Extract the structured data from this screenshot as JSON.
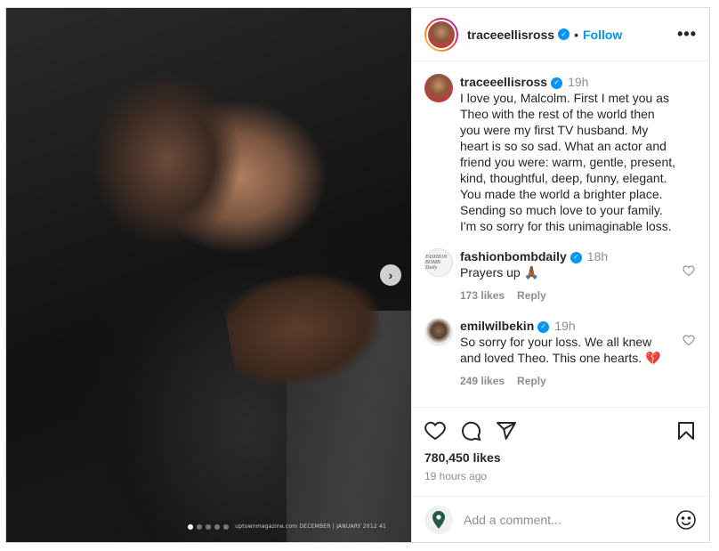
{
  "post": {
    "author": "traceeellisross",
    "follow_label": "Follow",
    "separator": "•",
    "more_label": "•••"
  },
  "media": {
    "magazine_text": "uptownmagazine.com   DECEMBER | JANUARY 2012   41",
    "next_label": "›",
    "slide_count": 5,
    "active_slide": 1
  },
  "caption": {
    "user": "traceeellisross",
    "time": "19h",
    "text": "I love you, Malcolm. First I met you as Theo with the rest of the world then you were my first TV husband. My heart is so so sad. What an actor and friend you were: warm, gentle, present, kind, thoughtful, deep, funny, elegant. You made the world a brighter place. Sending so much love to your family. I'm so sorry for this unimaginable loss."
  },
  "comments": [
    {
      "user": "fashionbombdaily",
      "time": "18h",
      "text": "Prayers up 🙏🏾",
      "likes": "173 likes",
      "reply": "Reply"
    },
    {
      "user": "emilwilbekin",
      "time": "19h",
      "text": "So sorry for your loss. We all knew and loved Theo. This one hearts. 💔",
      "likes": "249 likes",
      "reply": "Reply"
    }
  ],
  "fb_avatar_text": "FASHION BOMB Daily",
  "stats": {
    "likes": "780,450 likes",
    "posted": "19 hours ago"
  },
  "composer": {
    "placeholder": "Add a comment..."
  },
  "colors": {
    "accent": "#0095f6",
    "muted": "#8e8e8e",
    "text": "#262626"
  }
}
